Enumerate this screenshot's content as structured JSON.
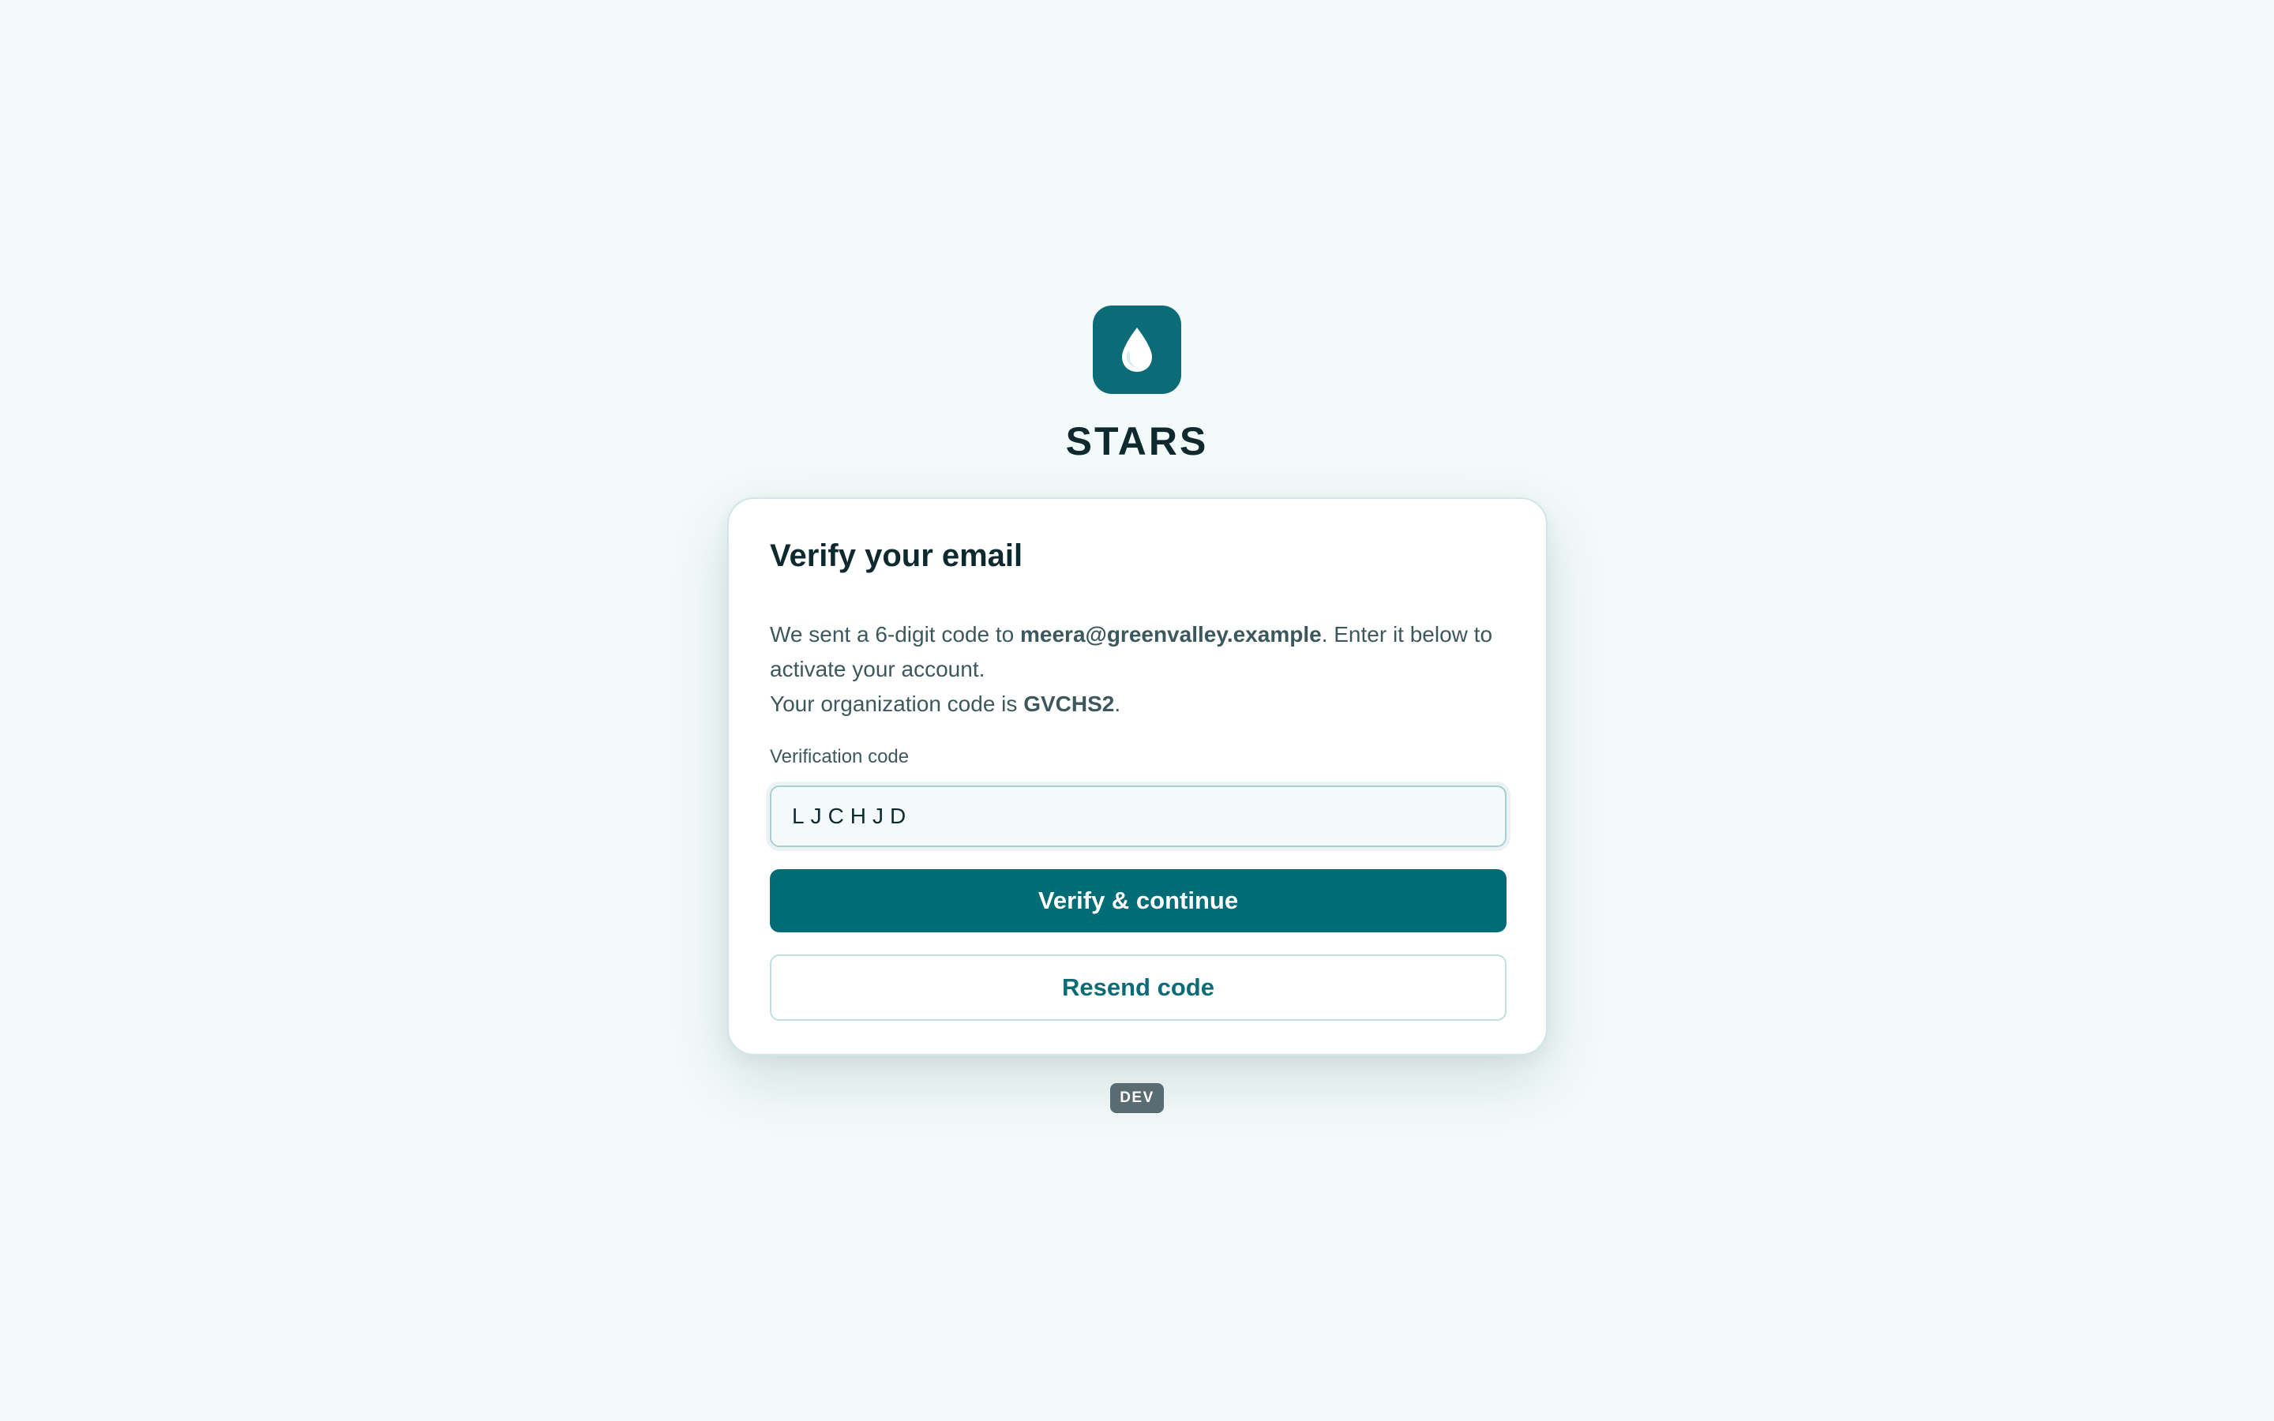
{
  "brand": {
    "name": "STARS",
    "logo_icon": "water-drop-icon",
    "logo_color": "#0b6b76"
  },
  "card": {
    "title": "Verify your email",
    "description": {
      "sent_prefix": "We sent a 6-digit code to ",
      "email": "meera@greenvalley.example",
      "sent_suffix": ". Enter it below to activate your account.",
      "org_prefix": "Your organization code is ",
      "org_code": "GVCHS2",
      "org_suffix": "."
    },
    "field_label": "Verification code",
    "code_value": "LJCHJD",
    "primary_button": "Verify & continue",
    "secondary_button": "Resend code"
  },
  "env_badge": "DEV",
  "colors": {
    "background": "#f3fafa",
    "accent": "#006c76",
    "badge": "#5b6b72"
  }
}
